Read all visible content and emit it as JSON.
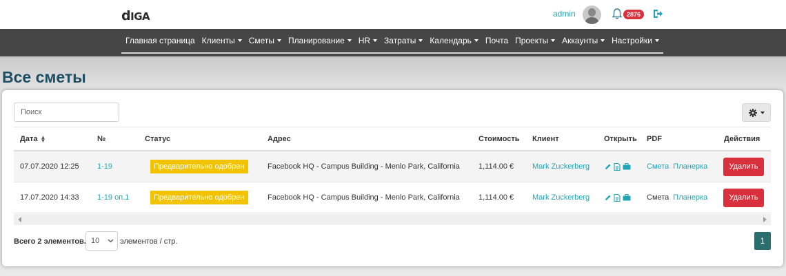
{
  "app": {
    "logo_text": "DIGA",
    "user_name": "admin",
    "notification_count": "2876"
  },
  "nav": {
    "items": [
      {
        "label": "Главная страница",
        "dropdown": false
      },
      {
        "label": "Клиенты",
        "dropdown": true
      },
      {
        "label": "Сметы",
        "dropdown": true
      },
      {
        "label": "Планирование",
        "dropdown": true
      },
      {
        "label": "HR",
        "dropdown": true
      },
      {
        "label": "Затраты",
        "dropdown": true
      },
      {
        "label": "Календарь",
        "dropdown": true
      },
      {
        "label": "Почта",
        "dropdown": false
      },
      {
        "label": "Проекты",
        "dropdown": true
      },
      {
        "label": "Аккаунты",
        "dropdown": true
      },
      {
        "label": "Настройки",
        "dropdown": true
      }
    ]
  },
  "page": {
    "title": "Все сметы"
  },
  "search": {
    "placeholder": "Поиск"
  },
  "table": {
    "columns": {
      "date": "Дата",
      "number": "№",
      "status": "Статус",
      "address": "Адрес",
      "cost": "Стоимость",
      "client": "Клиент",
      "open": "Открыть",
      "pdf": "PDF",
      "actions": "Действия"
    },
    "rows": [
      {
        "date": "07.07.2020 12:25",
        "number": "1-19",
        "status": "Предварительно одобрен",
        "address": "Facebook HQ - Campus Building - Menlo Park, California",
        "cost": "1,114.00 €",
        "client": "Mark Zuckerberg",
        "pdf_estimate": "Смета",
        "pdf_plan": "Планерка",
        "delete_label": "Удалить"
      },
      {
        "date": "17.07.2020 14:33",
        "number": "1-19 оп.1",
        "status": "Предварительно одобрен",
        "address": "Facebook HQ - Campus Building - Menlo Park, California",
        "cost": "1,114.00 €",
        "client": "Mark Zuckerberg",
        "pdf_estimate": "Смета",
        "pdf_plan": "Планерка",
        "delete_label": "Удалить"
      }
    ]
  },
  "footer": {
    "total_label": "Всего 2 элементов.",
    "page_size": "10",
    "per_page_label": "элементов / стр.",
    "current_page": "1"
  },
  "colors": {
    "accent": "#1fa5b5",
    "nav_bg": "#464646",
    "status_badge": "#f2c300",
    "danger": "#d9303e",
    "pagination": "#2b6e6e",
    "title": "#1d4e64"
  }
}
